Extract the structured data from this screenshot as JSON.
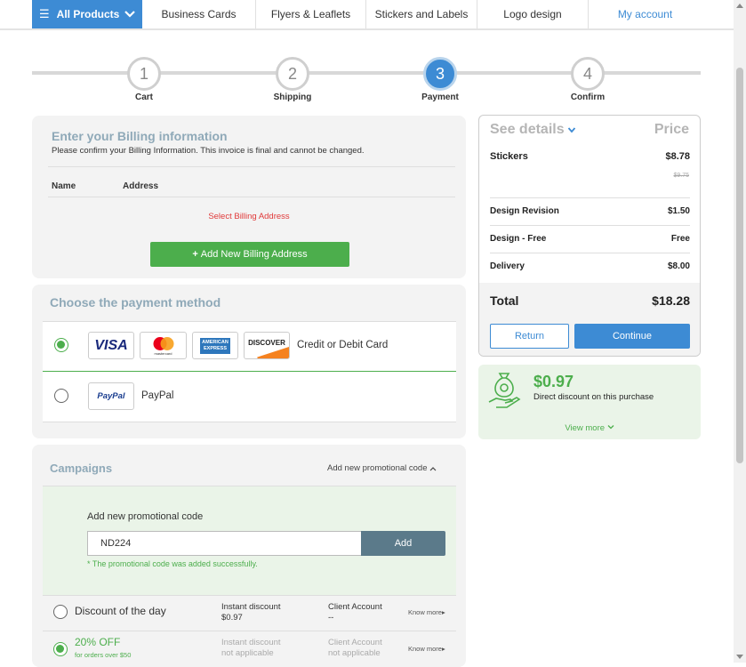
{
  "nav": {
    "all_products": "All Products",
    "tabs": [
      "Business Cards",
      "Flyers & Leaflets",
      "Stickers and Labels",
      "Logo design",
      "My account"
    ]
  },
  "stepper": {
    "steps": [
      {
        "num": "1",
        "label": "Cart"
      },
      {
        "num": "2",
        "label": "Shipping"
      },
      {
        "num": "3",
        "label": "Payment"
      },
      {
        "num": "4",
        "label": "Confirm"
      }
    ],
    "active_step": 3
  },
  "billing": {
    "title": "Enter your Billing information",
    "subtitle": "Please confirm your Billing Information. This invoice is final and cannot be changed.",
    "col_name": "Name",
    "col_address": "Address",
    "select_prompt": "Select Billing Address",
    "add_button": "Add New Billing Address"
  },
  "payment": {
    "title": "Choose the payment method",
    "card_logos": [
      "VISA",
      "mastercard",
      "AMERICAN EXPRESS",
      "DISCOVER"
    ],
    "card_label": "Credit or Debit Card",
    "paypal_logo": "PayPal",
    "paypal_label": "PayPal",
    "selected": "card"
  },
  "campaigns": {
    "title": "Campaigns",
    "add_toggle": "Add new promotional code",
    "promo_label": "Add new promotional code",
    "promo_value": "ND224",
    "add_button": "Add",
    "success_msg": "* The promotional code was added successfully.",
    "rows": [
      {
        "name": "Discount of the day",
        "sub": "",
        "instant_label": "Instant discount",
        "instant_value": "$0.97",
        "client_label": "Client Account",
        "client_value": "--",
        "know_more": "Know more",
        "selected": false
      },
      {
        "name": "20% OFF",
        "sub": "for orders over $50",
        "instant_label": "Instant discount",
        "instant_value": "not applicable",
        "client_label": "Client Account",
        "client_value": "not applicable",
        "know_more": "Know more",
        "selected": true
      }
    ]
  },
  "summary": {
    "see_details": "See details",
    "price_header": "Price",
    "items": [
      {
        "label": "Stickers",
        "value": "$8.78",
        "old": "$9.75"
      },
      {
        "label": "Design Revision",
        "value": "$1.50"
      },
      {
        "label": "Design - Free",
        "value": "Free"
      },
      {
        "label": "Delivery",
        "value": "$8.00"
      }
    ],
    "total_label": "Total",
    "total_value": "$18.28",
    "return_button": "Return",
    "continue_button": "Continue"
  },
  "discount_card": {
    "amount": "$0.97",
    "text": "Direct discount on this purchase",
    "view_more": "View more"
  },
  "colors": {
    "accent_blue": "#3d8bd4",
    "green": "#4cae4c",
    "panel_grey": "#f3f3f3",
    "title_grey_blue": "#8fa9b8",
    "error_red": "#e03a3a"
  },
  "icons": [
    "hamburger-icon",
    "chevron-down-icon",
    "plus-icon",
    "money-hand-icon",
    "chevron-up-icon"
  ]
}
